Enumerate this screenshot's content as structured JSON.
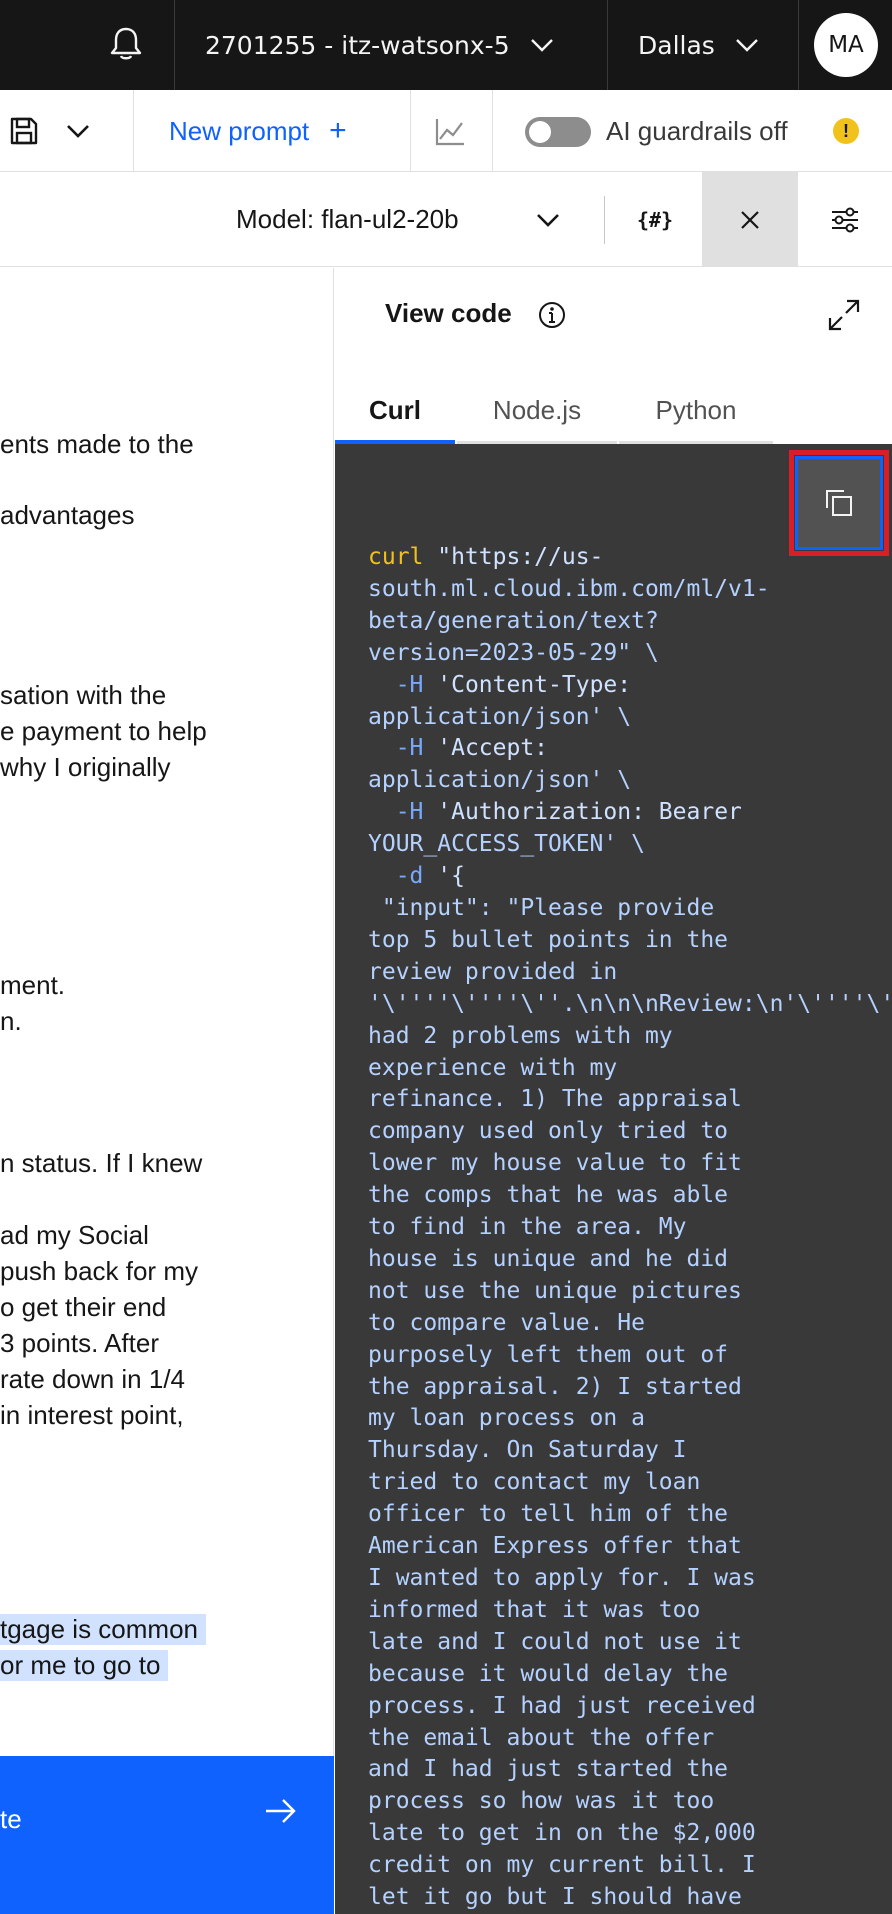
{
  "header": {
    "account_label": "2701255 - itz-watsonx-5",
    "region_label": "Dallas",
    "avatar_initials": "MA"
  },
  "toolbar": {
    "new_prompt_label": "New prompt",
    "new_prompt_plus": "+",
    "guardrails_label": "AI guardrails off",
    "guardrails_on": false,
    "warning_glyph": "!"
  },
  "model_bar": {
    "model_label": "Model: flan-ul2-20b",
    "variables_label": "{#}"
  },
  "prompt_panel": {
    "visible_lines": [
      "ents made to the",
      "advantages",
      "sation with the",
      "e payment to help",
      "why I originally",
      "ment.",
      "n.",
      "n status. If I knew",
      "ad my Social",
      "push back for my",
      "o get their end",
      "3 points. After",
      "rate down in 1/4",
      "in interest point,",
      "tgage is common",
      "or me to go to"
    ],
    "generate_label": "te"
  },
  "code_panel": {
    "title": "View code",
    "tabs": [
      "Curl",
      "Node.js",
      "Python"
    ],
    "active_tab": "Curl",
    "code_lines": [
      "curl \"https://us-",
      "south.ml.cloud.ibm.com/ml/v1-",
      "beta/generation/text?",
      "version=2023-05-29\" \\",
      "  -H 'Content-Type:",
      "application/json' \\",
      "  -H 'Accept:",
      "application/json' \\",
      "  -H 'Authorization: Bearer",
      "YOUR_ACCESS_TOKEN' \\",
      "  -d '{",
      " \"input\": \"Please provide",
      "top 5 bullet points in the",
      "review provided in",
      "'\\''''\\''''\\''.\\n\\n\\nReview:\\n'\\''''\\''''\\''I",
      "had 2 problems with my",
      "experience with my",
      "refinance. 1) The appraisal",
      "company used only tried to",
      "lower my house value to fit",
      "the comps that he was able",
      "to find in the area. My",
      "house is unique and he did",
      "not use the unique pictures",
      "to compare value. He",
      "purposely left them out of",
      "the appraisal. 2) I started",
      "my loan process on a",
      "Thursday. On Saturday I",
      "tried to contact my loan",
      "officer to tell him of the",
      "American Express offer that",
      "I wanted to apply for. I was",
      "informed that it was too",
      "late and I could not use it",
      "because it would delay the",
      "process. I had just received",
      "the email about the offer",
      "and I had just started the",
      "process so how was it too",
      "late to get in on the $2,000",
      "credit on my current bill. I",
      "let it go but I should have"
    ]
  },
  "icons": {
    "bell": "bell-icon",
    "save": "save-icon",
    "chart": "chart-icon",
    "info": "info-icon",
    "expand": "maximize-icon",
    "copy": "copy-icon",
    "close": "close-icon",
    "settings": "sliders-icon",
    "arrow": "arrow-right-icon"
  },
  "colors": {
    "accent": "#0f62fe",
    "header_bg": "#161616",
    "code_bg": "#393939",
    "highlight": "#d0e2ff",
    "warning": "#f1c21b",
    "annotation_red": "#da1e28"
  }
}
